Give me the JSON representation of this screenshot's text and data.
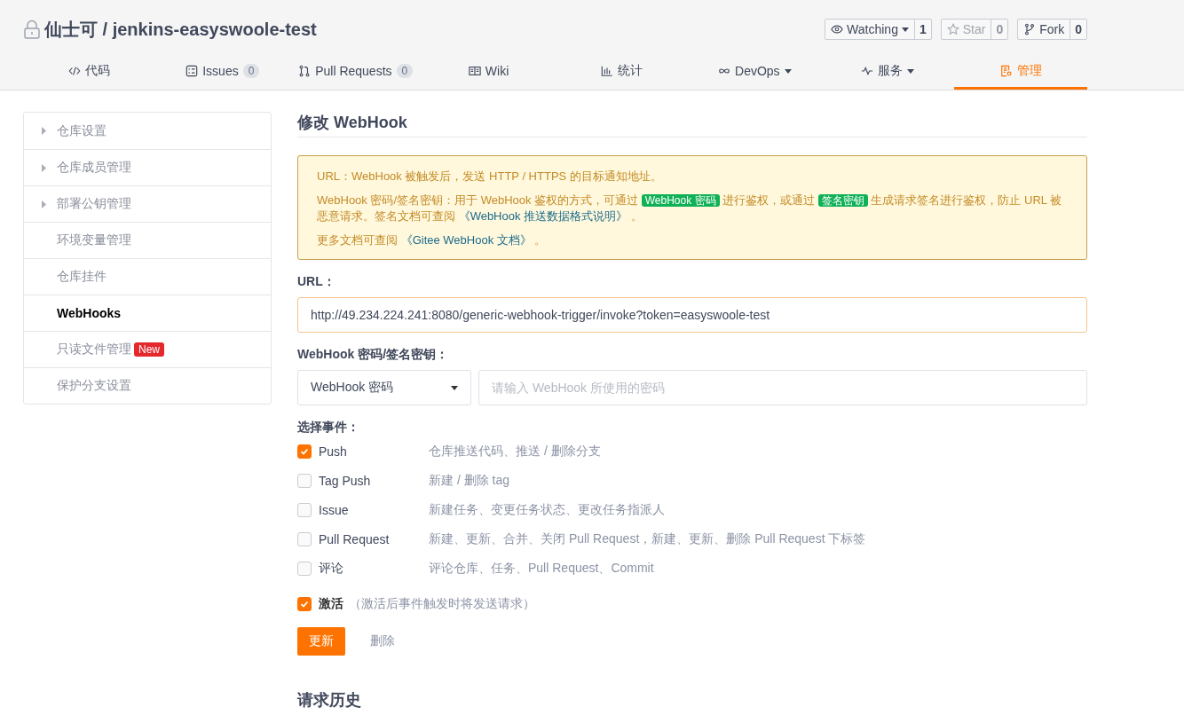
{
  "header": {
    "title": "仙士可 / jenkins-easyswoole-test",
    "private": true
  },
  "actions": [
    {
      "kind": "eye",
      "label": "Watching",
      "count": "1",
      "dropdown": true,
      "disabled": false
    },
    {
      "kind": "star",
      "label": "Star",
      "count": "0",
      "dropdown": false,
      "disabled": true
    },
    {
      "kind": "fork",
      "label": "Fork",
      "count": "0",
      "dropdown": false,
      "disabled": false
    }
  ],
  "tabs": [
    {
      "kind": "code",
      "label": "代码",
      "selected": false
    },
    {
      "kind": "issues",
      "label": "Issues",
      "count": "0",
      "selected": false
    },
    {
      "kind": "pr",
      "label": "Pull Requests",
      "count": "0",
      "selected": false
    },
    {
      "kind": "wiki",
      "label": "Wiki",
      "selected": false
    },
    {
      "kind": "stats",
      "label": "统计",
      "selected": false
    },
    {
      "kind": "devops",
      "label": "DevOps",
      "dropdown": true,
      "selected": false
    },
    {
      "kind": "service",
      "label": "服务",
      "dropdown": true,
      "selected": false
    },
    {
      "kind": "manage",
      "label": "管理",
      "selected": true
    }
  ],
  "sidebar": {
    "items": [
      {
        "label": "仓库设置",
        "expandable": true,
        "selected": false
      },
      {
        "label": "仓库成员管理",
        "expandable": true,
        "selected": false
      },
      {
        "label": "部署公钥管理",
        "expandable": true,
        "selected": false
      },
      {
        "label": "环境变量管理",
        "expandable": false,
        "selected": false
      },
      {
        "label": "仓库挂件",
        "expandable": false,
        "selected": false
      },
      {
        "label": "WebHooks",
        "expandable": false,
        "selected": true
      },
      {
        "label": "只读文件管理",
        "expandable": false,
        "selected": false,
        "badge": "New"
      },
      {
        "label": "保护分支设置",
        "expandable": false,
        "selected": false
      }
    ]
  },
  "form": {
    "heading": "修改 WebHook",
    "notice": [
      [
        {
          "kind": "text",
          "text": "URL：WebHook 被触发后，发送 HTTP / HTTPS 的目标通知地址。"
        }
      ],
      [
        {
          "kind": "text",
          "text": "WebHook 密码/签名密钥：用于 WebHook 鉴权的方式，可通过 "
        },
        {
          "kind": "badge",
          "text": "WebHook 密码"
        },
        {
          "kind": "text",
          "text": " 进行鉴权，或通过 "
        },
        {
          "kind": "badge",
          "text": "签名密钥"
        },
        {
          "kind": "text",
          "text": " 生成请求签名进行鉴权，防止 URL 被恶意请求。签名文档可查阅 "
        },
        {
          "kind": "link",
          "text": "《WebHook 推送数据格式说明》"
        },
        {
          "kind": "text",
          "text": " 。"
        }
      ],
      [
        {
          "kind": "text",
          "text": "更多文档可查阅 "
        },
        {
          "kind": "link",
          "text": "《Gitee WebHook 文档》"
        },
        {
          "kind": "text",
          "text": " 。"
        }
      ]
    ],
    "url_label": "URL：",
    "url_value": "http://49.234.224.241:8080/generic-webhook-trigger/invoke?token=easyswoole-test",
    "secret_label": "WebHook 密码/签名密钥：",
    "secret_type": "WebHook 密码",
    "secret_placeholder": "请输入 WebHook 所使用的密码",
    "events_label": "选择事件：",
    "events": [
      {
        "name": "Push",
        "description": "仓库推送代码、推送 / 删除分支",
        "checked": true
      },
      {
        "name": "Tag Push",
        "description": "新建 / 删除 tag",
        "checked": false
      },
      {
        "name": "Issue",
        "description": "新建任务、变更任务状态、更改任务指派人",
        "checked": false
      },
      {
        "name": "Pull Request",
        "description": "新建、更新、合并、关闭 Pull Request，新建、更新、删除 Pull Request 下标签",
        "checked": false
      },
      {
        "name": "评论",
        "description": "评论仓库、任务、Pull Request、Commit",
        "checked": false
      }
    ],
    "active": {
      "label": "激活",
      "hint": "（激活后事件触发时将发送请求）",
      "checked": true
    },
    "update_button": "更新",
    "delete_button": "删除"
  },
  "history": {
    "heading": "请求历史"
  }
}
